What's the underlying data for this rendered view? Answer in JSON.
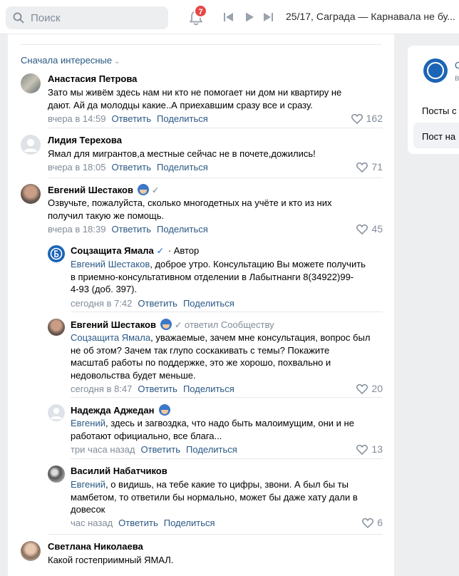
{
  "topbar": {
    "search_placeholder": "Поиск",
    "notifications_count": "7",
    "track": "25/17, Саграда — Карнавала не бу..."
  },
  "sort_label": "Сначала интересные",
  "right_panel": {
    "name_initial": "С",
    "sub": "в",
    "posts_label": "Посты с",
    "post_label": "Пост на"
  },
  "actions": {
    "reply": "Ответить",
    "share": "Поделиться"
  },
  "comments": [
    {
      "name": "Анастасия Петрова",
      "text_l1": "Зато мы живём здесь нам ни кто не помогает ни дом ни квартиру не",
      "text_l2": "дают. Ай да молодцы какие..А приехавшим сразу все и сразу.",
      "time": "вчера в 14:59",
      "likes": "162"
    },
    {
      "name": "Лидия Терехова",
      "text_l1": "Ямал для мигрантов,а местные сейчас не в почете,дожились!",
      "time": "вчера в 18:05",
      "likes": "71"
    },
    {
      "name": "Евгений Шестаков",
      "text_l1": "Озвучьте, пожалуйста, сколько многодетных на учёте и кто из них",
      "text_l2": "получил такую же помощь.",
      "time": "вчера в 18:39",
      "likes": "45"
    }
  ],
  "replies": [
    {
      "name": "Соцзащита Ямала",
      "role": "· Автор",
      "mention": "Евгений Шестаков",
      "text_l1": ", доброе утро. Консультацию Вы можете получить",
      "text_l2": "в приемно-консультативном отделении в Лабытнанги 8(34922)99-",
      "text_l3": "4-93 (доб. 397).",
      "time": "сегодня в 7:42"
    },
    {
      "name": "Евгений Шестаков",
      "note": "ответил Сообществу",
      "mention": "Соцзащита Ямала",
      "text_l1": ", уважаемые, зачем мне консультация, вопрос был",
      "text_l2": "не об этом? Зачем так глупо соскакивать с темы? Покажите",
      "text_l3": "масштаб работы по поддержке, это же хорошо, похвально и",
      "text_l4": "недовольства будет меньше.",
      "time": "сегодня в 8:47",
      "likes": "20"
    },
    {
      "name": "Надежда Аджедан",
      "mention": "Евгений",
      "text_l1": ", здесь и загвоздка, что надо быть малоимущим, они и не",
      "text_l2": "работают официально, все блага...",
      "time": "три часа назад",
      "likes": "13"
    },
    {
      "name": "Василий Набатчиков",
      "mention": "Евгений",
      "text_l1": ", о видишь, на тебе какие то цифры, звони. А был бы ты",
      "text_l2": "мамбетом, то ответили бы нормально, может бы даже хату дали в",
      "text_l3": "довесок",
      "time": "час назад",
      "likes": "6"
    }
  ],
  "last_comment": {
    "name": "Светлана Николаева",
    "text_l1": "Какой гостеприимный ЯМАЛ."
  }
}
